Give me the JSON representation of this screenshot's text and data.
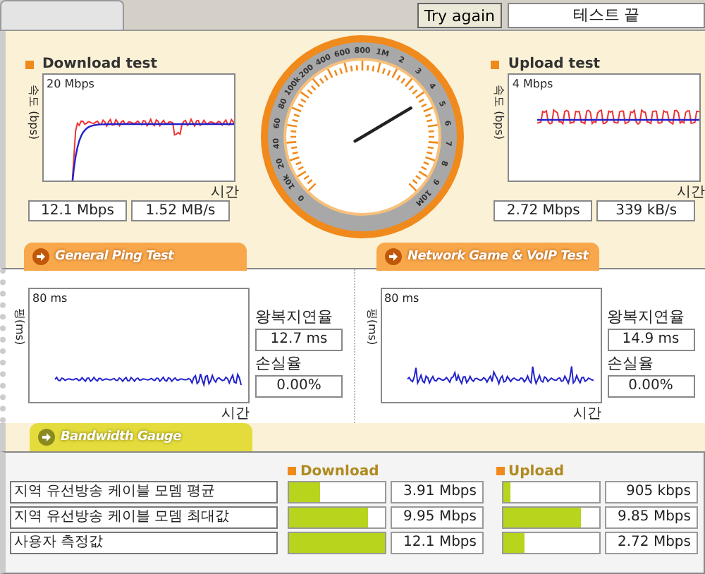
{
  "toolbar": {
    "try_again": "Try again",
    "status": "테스트 끝"
  },
  "speed_tests": [
    {
      "title": "Download test",
      "y_axis": "속도 (bps)",
      "scale": "20 Mbps",
      "x_axis": "시간",
      "readings": [
        "12.1 Mbps",
        "1.52 MB/s"
      ]
    },
    {
      "title": "Upload test",
      "y_axis": "속도 (bps)",
      "scale": "4 Mbps",
      "x_axis": "시간",
      "readings": [
        "2.72 Mbps",
        "339 kB/s"
      ]
    }
  ],
  "gauge": {
    "labels": [
      "0",
      "10k",
      "20",
      "40",
      "60",
      "80",
      "100k",
      "200",
      "400",
      "600",
      "800",
      "1M",
      "2",
      "3",
      "4",
      "5",
      "6",
      "7",
      "8",
      "9",
      "10M"
    ]
  },
  "section_tabs": [
    "General Ping Test",
    "Network Game & VoIP Test"
  ],
  "ping_tests": [
    {
      "y_axis": "핑(ms)",
      "scale": "80 ms",
      "x_axis": "시간",
      "latency_label": "왕복지연율",
      "latency": "12.7 ms",
      "loss_label": "손실율",
      "loss": "0.00%"
    },
    {
      "y_axis": "핑(ms)",
      "scale": "80 ms",
      "x_axis": "시간",
      "latency_label": "왕복지연율",
      "latency": "14.9 ms",
      "loss_label": "손실율",
      "loss": "0.00%"
    }
  ],
  "bandwidth": {
    "tab": "Bandwidth Gauge",
    "columns": [
      "Download",
      "Upload"
    ],
    "rows": [
      {
        "label": "지역 유선방송 케이블 모뎀 평균",
        "download": {
          "level": 0.32,
          "value": "3.91 Mbps"
        },
        "upload": {
          "level": 0.075,
          "value": "905 kbps"
        }
      },
      {
        "label": "지역 유선방송 케이블 모뎀 최대값",
        "download": {
          "level": 0.82,
          "value": "9.95 Mbps"
        },
        "upload": {
          "level": 0.81,
          "value": "9.85 Mbps"
        }
      },
      {
        "label": "사용자 측정값",
        "download": {
          "level": 1,
          "value": "12.1 Mbps"
        },
        "upload": {
          "level": 0.22,
          "value": "2.72 Mbps"
        }
      }
    ]
  }
}
